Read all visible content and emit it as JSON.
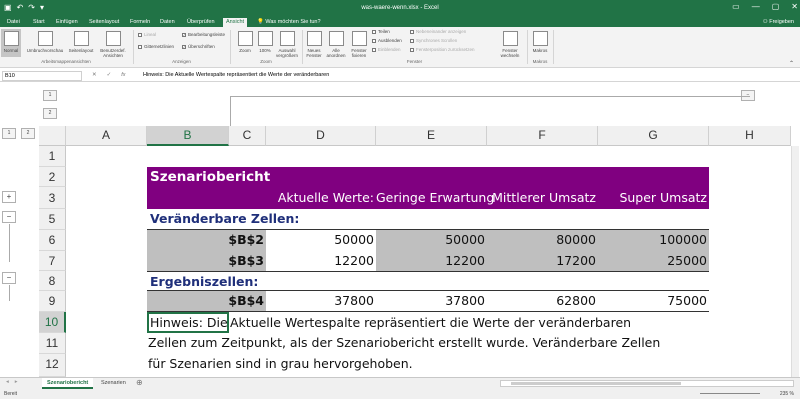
{
  "window": {
    "title": "was-waere-wenn.xlsx - Excel"
  },
  "tabs": [
    {
      "label": "Datei"
    },
    {
      "label": "Start"
    },
    {
      "label": "Einfügen"
    },
    {
      "label": "Seitenlayout"
    },
    {
      "label": "Formeln"
    },
    {
      "label": "Daten"
    },
    {
      "label": "Überprüfen"
    },
    {
      "label": "Ansicht"
    }
  ],
  "tell_me": "Was möchten Sie tun?",
  "share": "Freigeben",
  "ribbon": {
    "normal": "Normal",
    "umbruch": "Umbruchvorschau",
    "seitenlayout": "Seitenlayout",
    "benutzerdef": "Benutzerdef. Ansichten",
    "group_views": "Arbeitsmappenansichten",
    "lineal": "Lineal",
    "bearbeitungsleiste": "Bearbeitungsleiste",
    "gitternetzlinien": "Gitternetzlinien",
    "ueberschriften": "Überschriften",
    "group_show": "Anzeigen",
    "zoom": "Zoom",
    "hundred": "100%",
    "auswahl": "Auswahl vergrößern",
    "group_zoom": "Zoom",
    "neues_fenster": "Neues Fenster",
    "alle_anordnen": "Alle anordnen",
    "fenster_fixieren": "Fenster fixieren",
    "teilen": "Teilen",
    "ausblenden": "Ausblenden",
    "einblenden": "Einblenden",
    "nebeneinander": "Nebeneinander anzeigen",
    "synchrones": "Synchrones Scrollen",
    "fensterposition": "Fensterposition zurücksetzen",
    "fenster_wechseln": "Fenster wechseln",
    "group_window": "Fenster",
    "makros": "Makros",
    "group_macros": "Makros"
  },
  "formula_bar": {
    "name_box": "B10",
    "formula": "Hinweis: Die Aktuelle Wertespalte repräsentiert die Werte der veränderbaren"
  },
  "outline_levels": {
    "row": [
      "1",
      "2"
    ],
    "col": [
      "1",
      "2"
    ],
    "plus": "+",
    "minus": "−"
  },
  "columns": [
    "A",
    "B",
    "C",
    "D",
    "E",
    "F",
    "G",
    "H"
  ],
  "rows": [
    "1",
    "2",
    "3",
    "5",
    "6",
    "7",
    "8",
    "9",
    "10",
    "11",
    "12"
  ],
  "sheet": {
    "title": "Szenariobericht",
    "headers": [
      "Aktuelle Werte:",
      "Geringe Erwartung",
      "Mittlerer Umsatz",
      "Super Umsatz"
    ],
    "changing_label": "Veränderbare Zellen:",
    "changing_rows": [
      {
        "ref": "$B$2",
        "values": [
          "50000",
          "50000",
          "80000",
          "100000"
        ]
      },
      {
        "ref": "$B$3",
        "values": [
          "12200",
          "12200",
          "17200",
          "25000"
        ]
      }
    ],
    "result_label": "Ergebniszellen:",
    "result_rows": [
      {
        "ref": "$B$4",
        "values": [
          "37800",
          "37800",
          "62800",
          "75000"
        ]
      }
    ],
    "note_first": "Hinweis: Die",
    "note_rest": "Aktuelle Wertespalte repräsentiert die Werte der veränderbaren",
    "note_line2": "Zellen zum Zeitpunkt, als der Szenariobericht erstellt wurde. Veränderbare Zellen",
    "note_line3": "für Szenarien sind in grau hervorgehoben."
  },
  "sheet_tabs": [
    {
      "label": "Szenariobericht",
      "active": true
    },
    {
      "label": "Szenarien",
      "active": false
    }
  ],
  "status": {
    "ready": "Bereit",
    "zoom": "235 %"
  },
  "colors": {
    "excel_green": "#217346",
    "title_purple": "#800080",
    "highlight_grey": "#bfbfbf",
    "navy": "#1f2f7a"
  }
}
